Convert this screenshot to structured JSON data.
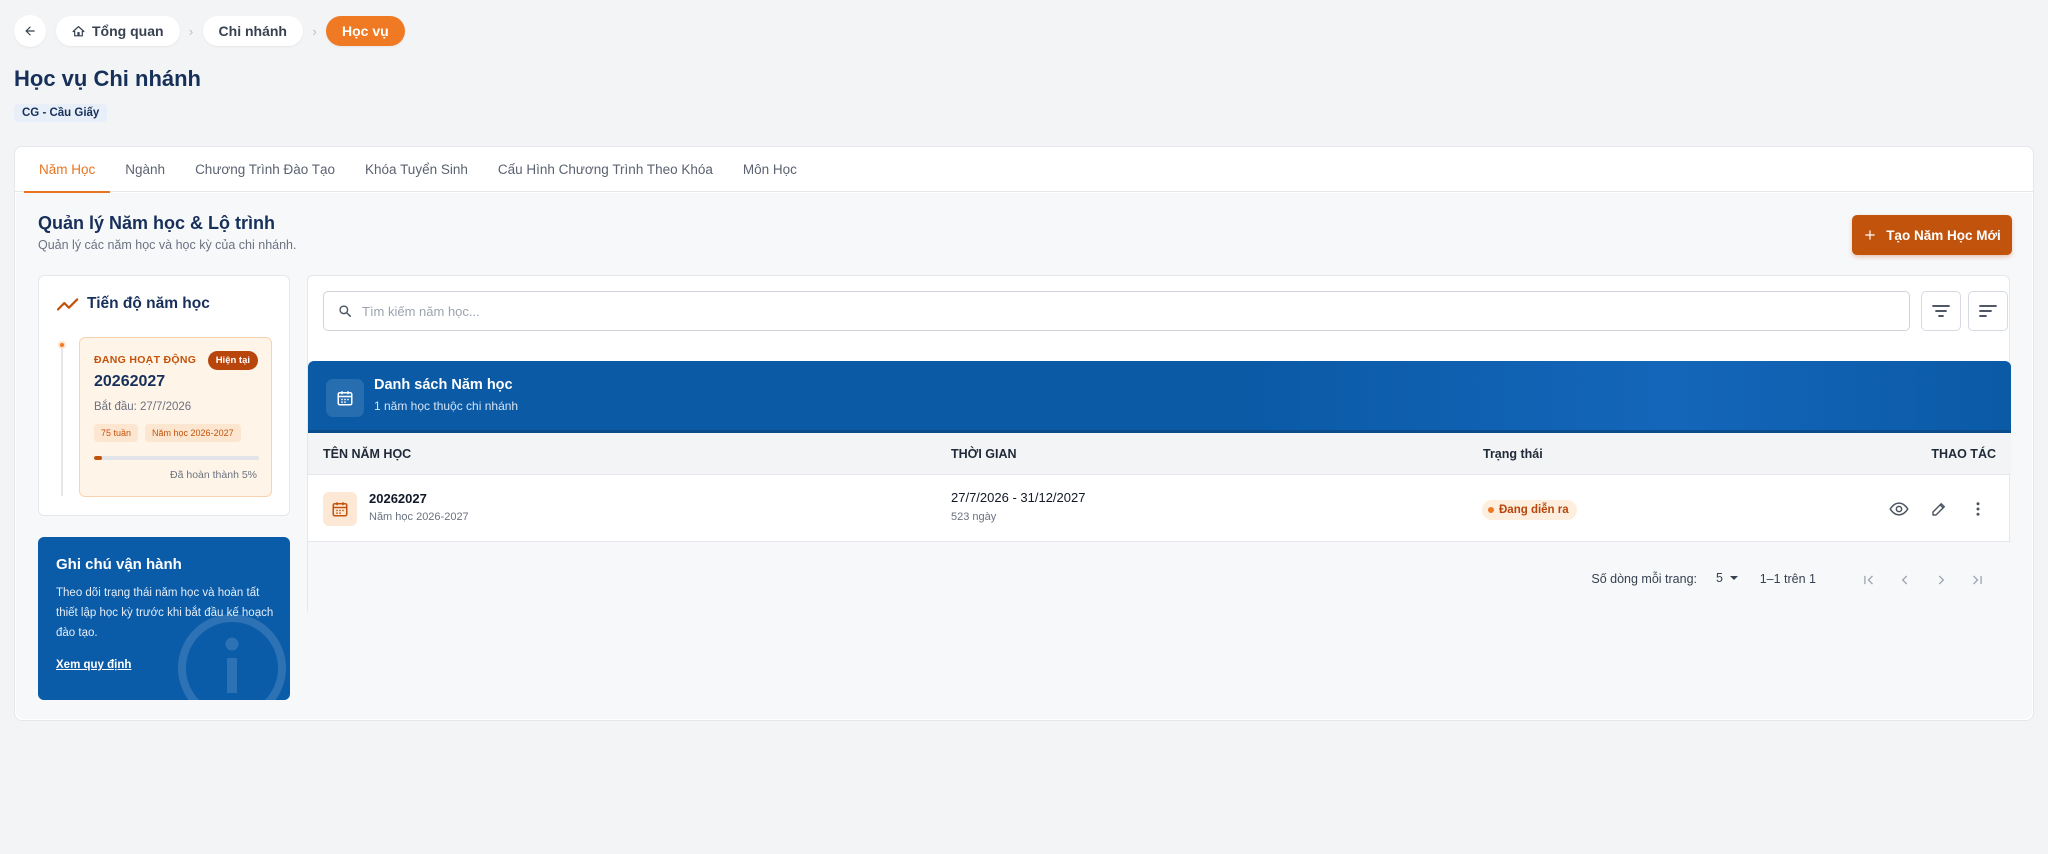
{
  "breadcrumb": {
    "items": [
      {
        "label": "Tổng quan"
      },
      {
        "label": "Chi nhánh"
      },
      {
        "label": "Học vụ"
      }
    ]
  },
  "page": {
    "title": "Học vụ Chi nhánh",
    "branch_badge": "CG - Cầu Giấy"
  },
  "tabs": [
    {
      "label": "Năm Học",
      "active": true
    },
    {
      "label": "Ngành"
    },
    {
      "label": "Chương Trình Đào Tạo"
    },
    {
      "label": "Khóa Tuyển Sinh"
    },
    {
      "label": "Cấu Hình Chương Trình Theo Khóa"
    },
    {
      "label": "Môn Học"
    }
  ],
  "section": {
    "title": "Quản lý Năm học & Lộ trình",
    "subtitle": "Quản lý các năm học và học kỳ của chi nhánh.",
    "create_button": "Tạo Năm Học Mới"
  },
  "progress": {
    "title": "Tiến độ năm học",
    "status": "ĐANG HOẠT ĐỘNG",
    "badge": "Hiện tại",
    "year": "20262027",
    "start": "Bắt đầu: 27/7/2026",
    "tags": [
      "75 tuần",
      "Năm học 2026-2027"
    ],
    "percent": 5,
    "percent_label": "Đã hoàn thành 5%"
  },
  "note": {
    "title": "Ghi chú vận hành",
    "text": "Theo dõi trạng thái năm học và hoàn tất thiết lập học kỳ trước khi bắt đầu kế hoạch đào tạo.",
    "link": "Xem quy định"
  },
  "search": {
    "placeholder": "Tìm kiếm năm học..."
  },
  "table": {
    "title": "Danh sách Năm học",
    "subtitle": "1 năm học thuộc chi nhánh",
    "columns": [
      "TÊN NĂM HỌC",
      "THỜI GIAN",
      "Trạng thái",
      "THAO TÁC"
    ],
    "rows": [
      {
        "name": "20262027",
        "name_sub": "Năm học 2026-2027",
        "time": "27/7/2026 - 31/12/2027",
        "time_sub": "523 ngày",
        "status": "Đang diễn ra"
      }
    ]
  },
  "pagination": {
    "rows_per_page_label": "Số dòng mỗi trang:",
    "rows_per_page": "5",
    "range": "1–1 trên 1"
  },
  "colors": {
    "accent": "#f07a24",
    "primary_dark": "#c2530c",
    "navy": "#17305a",
    "blue": "#0a5ba8"
  },
  "icons": [
    "back-arrow-icon",
    "home-icon",
    "plus-icon",
    "trend-icon",
    "info-icon",
    "search-icon",
    "filter-icon",
    "sort-icon",
    "calendar-icon",
    "eye-icon",
    "pencil-icon",
    "more-vertical-icon",
    "chevron-down-icon",
    "first-page-icon",
    "prev-page-icon",
    "next-page-icon",
    "last-page-icon"
  ]
}
